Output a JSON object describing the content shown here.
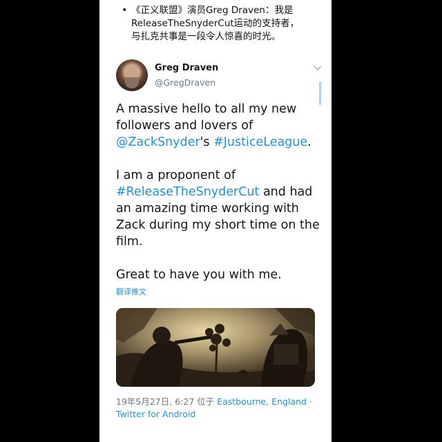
{
  "article": {
    "bullet_line1": "《正义联盟》演员Greg Draven：我是",
    "bullet_line2": "ReleaseTheSnyderCut运动的支持者，",
    "bullet_line3": "与扎克共事是一段令人惊喜的时光。"
  },
  "tweet": {
    "author_name": "Greg Draven",
    "author_handle": "@GregDraven",
    "avatar_icon": "person-avatar",
    "menu_icon": "chevron-down-icon",
    "para1_text1": "A massive hello to all my new followers and lovers of ",
    "para1_mention": "@ZackSnyder",
    "para1_text2": "'s ",
    "para1_hashtag": "#JusticeLeague",
    "para1_text3": ".",
    "para2_text1": "I am a proponent of ",
    "para2_hashtag": "#ReleaseTheSnyderCut",
    "para2_text2": " and had an amazing time working with Zack during my short time on the film.",
    "para3": "Great to have you with me.",
    "translate_label": "翻译推文",
    "media_description_icon": "video-still-image",
    "timestamp": "19年5月27日, 6:27 位于 ",
    "location": "Eastbourne, England",
    "location_sep": " ·",
    "source": "Twitter for Android"
  },
  "colors": {
    "link": "#1b95e0",
    "text": "#14171a",
    "muted": "#657786",
    "background": "#000000",
    "card": "#ffffff"
  }
}
